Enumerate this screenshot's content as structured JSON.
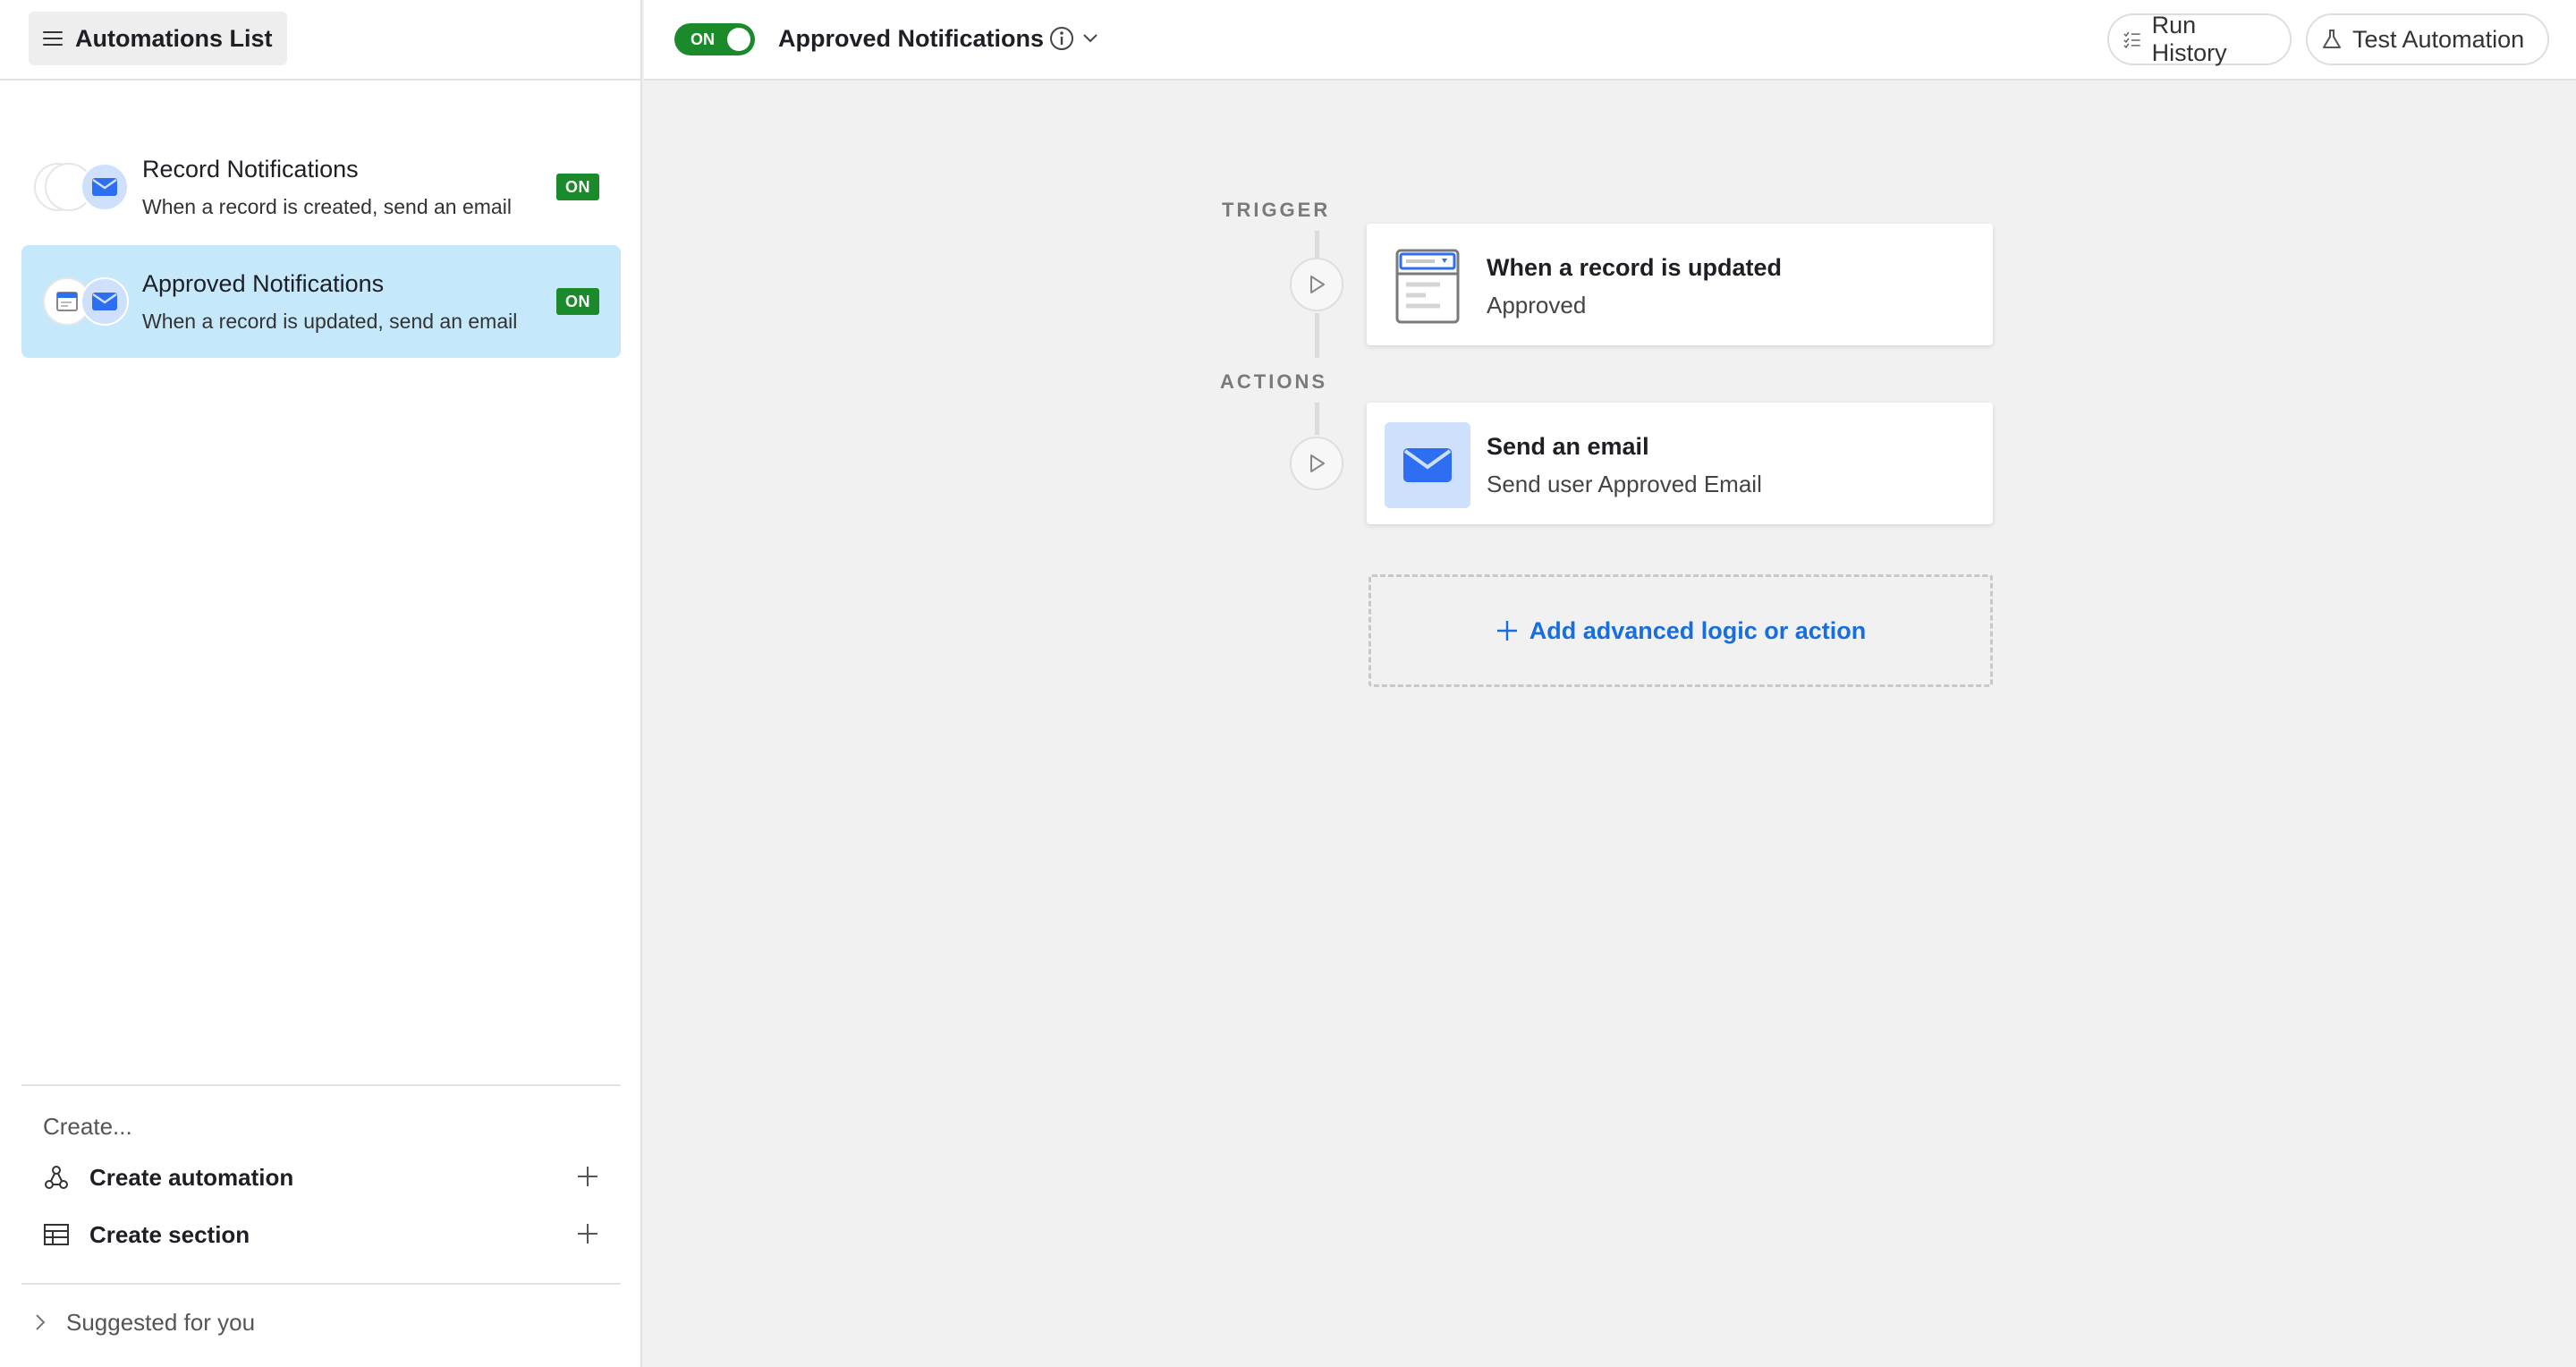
{
  "sidebar": {
    "list_button_label": "Automations List",
    "automations": [
      {
        "title": "Record Notifications",
        "description": "When a record is created, send an email",
        "status": "ON"
      },
      {
        "title": "Approved Notifications",
        "description": "When a record is updated, send an email",
        "status": "ON"
      }
    ],
    "create_label": "Create...",
    "create_automation_label": "Create automation",
    "create_section_label": "Create section",
    "suggested_label": "Suggested for you"
  },
  "topbar": {
    "toggle_label": "ON",
    "title": "Approved Notifications",
    "run_history_label": "Run History",
    "test_automation_label": "Test Automation"
  },
  "canvas": {
    "trigger_label": "TRIGGER",
    "actions_label": "ACTIONS",
    "trigger_card": {
      "title": "When a record is updated",
      "subtitle": "Approved"
    },
    "action_card": {
      "title": "Send an email",
      "subtitle": "Send user Approved Email"
    },
    "add_label": "Add advanced logic or action"
  },
  "colors": {
    "accent_blue": "#166ee1",
    "on_green": "#1b8a2b",
    "selected_bg": "#c5e9fb",
    "mail_icon_bg": "#cfe0fd"
  }
}
